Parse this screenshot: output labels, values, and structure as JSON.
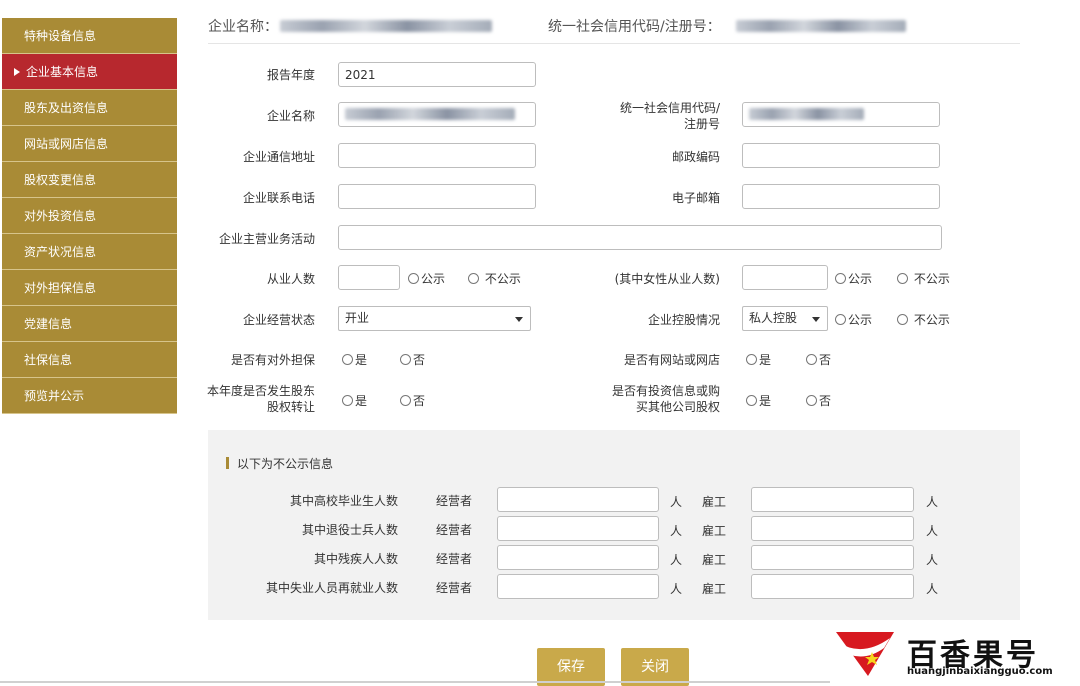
{
  "sidebar": {
    "items": [
      {
        "label": "特种设备信息",
        "active": false
      },
      {
        "label": "企业基本信息",
        "active": true
      },
      {
        "label": "股东及出资信息",
        "active": false
      },
      {
        "label": "网站或网店信息",
        "active": false
      },
      {
        "label": "股权变更信息",
        "active": false
      },
      {
        "label": "对外投资信息",
        "active": false
      },
      {
        "label": "资产状况信息",
        "active": false
      },
      {
        "label": "对外担保信息",
        "active": false
      },
      {
        "label": "党建信息",
        "active": false
      },
      {
        "label": "社保信息",
        "active": false
      },
      {
        "label": "预览并公示",
        "active": false
      }
    ]
  },
  "header": {
    "company_name_label": "企业名称：",
    "credit_code_label": "统一社会信用代码/注册号："
  },
  "form": {
    "report_year_label": "报告年度",
    "report_year_value": "2021",
    "company_name_label": "企业名称",
    "credit_code_label_line1": "统一社会信用代码/",
    "credit_code_label_line2": "注册号",
    "address_label": "企业通信地址",
    "postcode_label": "邮政编码",
    "phone_label": "企业联系电话",
    "email_label": "电子邮箱",
    "business_label": "企业主营业务活动",
    "employees_label": "从业人数",
    "female_employees_label": "(其中女性从业人数)",
    "public_label": "公示",
    "not_public_label": "不公示",
    "status_label": "企业经营状态",
    "status_value": "开业",
    "holding_label": "企业控股情况",
    "holding_value": "私人控股",
    "guarantee_label": "是否有对外担保",
    "website_label": "是否有网站或网店",
    "equity_transfer_label_line1": "本年度是否发生股东",
    "equity_transfer_label_line2": "股权转让",
    "investment_label_line1": "是否有投资信息或购",
    "investment_label_line2": "买其他公司股权",
    "yes_label": "是",
    "no_label": "否"
  },
  "nonpublic": {
    "title": "以下为不公示信息",
    "operator_label": "经营者",
    "employee_label": "雇工",
    "unit": "人",
    "rows": [
      {
        "label": "其中高校毕业生人数"
      },
      {
        "label": "其中退役士兵人数"
      },
      {
        "label": "其中残疾人人数"
      },
      {
        "label": "其中失业人员再就业人数"
      }
    ]
  },
  "buttons": {
    "save": "保存",
    "close": "关闭"
  },
  "watermark": {
    "text": "百香果号",
    "url": "huangjinbaixiangguo.com"
  }
}
